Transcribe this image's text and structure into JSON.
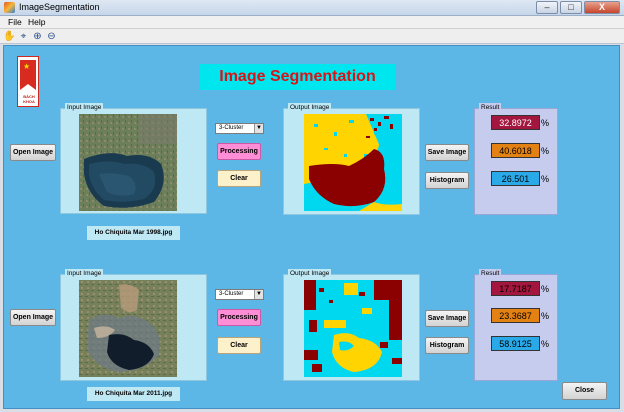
{
  "window": {
    "title": "ImageSegmentation",
    "minimize": "–",
    "maximize": "□",
    "close": "X"
  },
  "menu": [
    "File",
    "Help"
  ],
  "toolbar": [
    "hand-icon",
    "data-cursor-icon",
    "zoom-in-icon",
    "zoom-out-icon"
  ],
  "app": {
    "title": "Image Segmentation"
  },
  "colors": {
    "cluster_1": "#8b0000",
    "cluster_2": "#ffd400",
    "cluster_3": "#00d8f0",
    "result_1_bg": "#a3163d",
    "result_2_bg": "#e38112",
    "result_3_bg": "#2aa9e8"
  },
  "rows": [
    {
      "open_label": "Open Image",
      "input_legend": "Input Image",
      "output_legend": "Output Image",
      "result_legend": "Result",
      "cluster_select": "3-Cluster",
      "processing_label": "Processing",
      "clear_label": "Clear",
      "save_label": "Save Image",
      "histogram_label": "Histogram",
      "filename": "Ho Chiquita Mar 1998.jpg",
      "results": [
        "32.8972",
        "40.6018",
        "26.501"
      ],
      "percent": "%"
    },
    {
      "open_label": "Open Image",
      "input_legend": "Input Image",
      "output_legend": "Output Image",
      "result_legend": "Result",
      "cluster_select": "3-Cluster",
      "processing_label": "Processing",
      "clear_label": "Clear",
      "save_label": "Save Image",
      "histogram_label": "Histogram",
      "filename": "Ho Chiquita Mar 2011.jpg",
      "results": [
        "17.7187",
        "23.3687",
        "58.9125"
      ],
      "percent": "%"
    }
  ],
  "close_label": "Close"
}
